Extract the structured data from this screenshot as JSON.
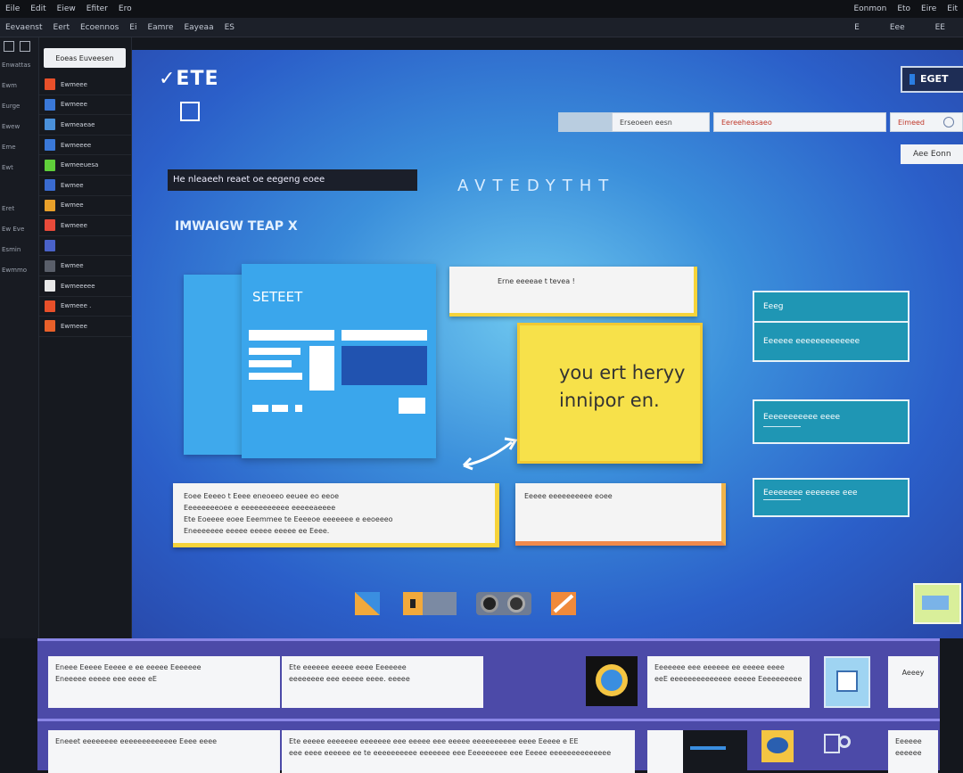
{
  "menubar": {
    "items": [
      "Eile",
      "Edit",
      "Eiew",
      "Efiter",
      "Ero"
    ],
    "right_items": [
      "Eonmon",
      "Eto",
      "Eire",
      "Eit"
    ]
  },
  "toolbar": {
    "items": [
      "Eevaenst",
      "Eert",
      "Ecoennos",
      "Ei",
      "Eamre",
      "Eayeaa",
      "ES"
    ],
    "right_items": [
      "E",
      "Eee",
      "EE"
    ]
  },
  "rail": {
    "labels": [
      "Enwattas",
      "Ewm",
      "Eurge",
      "Ewew",
      "Eme",
      "Ewt",
      "",
      "Eret",
      "Ew Eve",
      "Esmin",
      "Ewmmo"
    ]
  },
  "filepanel": {
    "button_label": "Eoeas Euveesen",
    "items": [
      {
        "label": "Ewmeee",
        "color": "#e8502a"
      },
      {
        "label": "Ewmeee",
        "color": "#3a78d8"
      },
      {
        "label": "Ewmeaeae",
        "color": "#4a90d9"
      },
      {
        "label": "Ewmeeee",
        "color": "#3a78d8"
      },
      {
        "label": "Ewmeeuesa",
        "color": "#5fcf3a"
      },
      {
        "label": "Ewmee",
        "color": "#3a6bd0"
      },
      {
        "label": "Ewmee",
        "color": "#e8a02a"
      },
      {
        "label": "Ewmeee",
        "color": "#e84a3a"
      },
      {
        "label": "",
        "color": "#4a62c8"
      },
      {
        "label": "Ewmee",
        "color": "#5a5f6a"
      },
      {
        "label": "Ewmeeeee",
        "color": "#e8e8e8"
      },
      {
        "label": "Ewmeee .",
        "color": "#e8502a"
      },
      {
        "label": "Ewmeee",
        "color": "#e8602a"
      }
    ]
  },
  "canvas": {
    "logo": "✓ETE",
    "dark_label": "He nleaeeh reaet oe eegeng eoee",
    "spaced_title": "AVTEDYTHT",
    "sub_title": "IMWAIGW TEAP X",
    "search_fields": [
      "Erseoeen eesn",
      "Eereeheasaeo",
      "Eimeed"
    ],
    "mini_input": "EGET",
    "right_button": "Aee Eonn",
    "doc_title": "SETEET",
    "note_top": "Erne eeeeae t tevea !",
    "sticky_lines": [
      "you ert heryy",
      "innipor en."
    ],
    "note_left_lines": [
      "Eoee Eeeeo t Eeee eneoeeo eeuee eo eeoe",
      "Eeeeeeeeoee e eeeeeeeeeee eeeeeaeeee",
      "Ete Eoeeee eoee Eeemmee te Eeeeoe eeeeeee e eeoeeeo",
      "Eneeeeeee eeeee eeeee eeeee ee Eeee."
    ],
    "note_mid": "Eeeee eeeeeeeeee eoee",
    "teal_cards": [
      {
        "rows": [
          "Eeeg",
          "Eeeeee eeeeeeeeeeeee"
        ]
      },
      {
        "rows": [
          "Eeeeeeeeeee eeee"
        ]
      },
      {
        "rows": [
          "Eeeeeeee eeeeeee eee"
        ]
      }
    ]
  },
  "bottom": {
    "band1": [
      {
        "lines": [
          "Eneee Eeeee Eeeee e ee eeeee Eeeeeee",
          "Eneeeee eeeee eee eeee eE"
        ]
      },
      {
        "lines": [
          "Ete eeeeee eeeee eeee Eeeeeee",
          "eeeeeeee eee eeeee eeee. eeeee"
        ]
      },
      {
        "lines": [
          "Eeeeeee eee eeeeee ee eeeee eeee",
          "eeE eeeeeeeeeeeeee eeeee Eeeeeeeeee"
        ]
      },
      {
        "lines": [
          "Aeeey"
        ]
      }
    ],
    "band2": [
      {
        "lines": [
          "Eneeet eeeeeeee eeeeeeeeeeeee Eeee eeee"
        ]
      },
      {
        "lines": [
          "Ete eeeee eeeeeee eeeeeee eee eeeee eee eeeee eeeeeeeeee eeee Eeeee e EE",
          "eee eeee eeeeee ee te eeeeeeeeee eeeeeee eee Eeeeeeeee eee Eeeee eeeeeeeeeeeeee"
        ]
      },
      {
        "lines": [
          "Eeeeee",
          "eeeeee"
        ]
      }
    ]
  }
}
